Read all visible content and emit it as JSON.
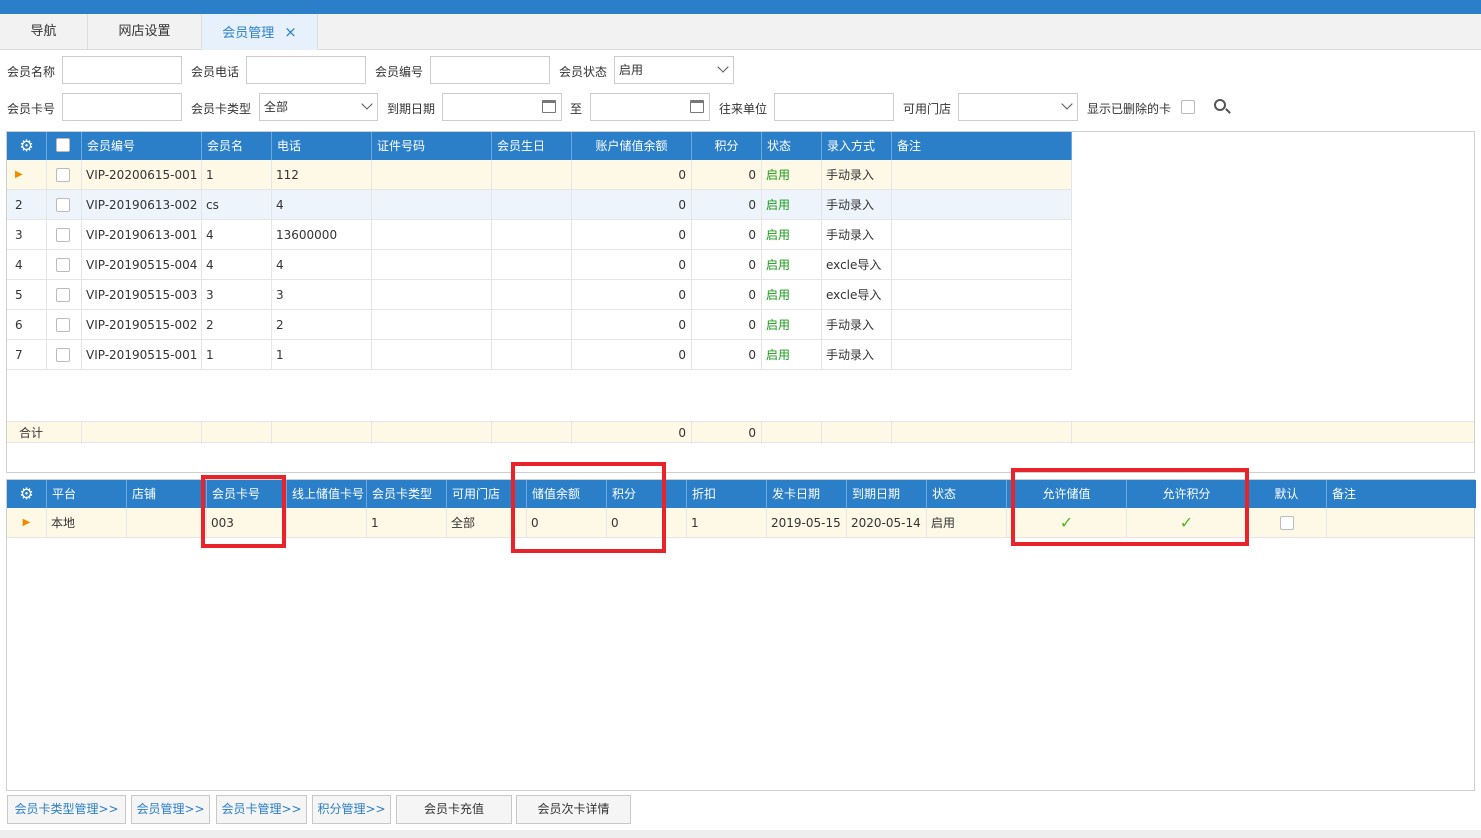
{
  "tabs": [
    {
      "label": "导航"
    },
    {
      "label": "网店设置"
    },
    {
      "label": "会员管理",
      "close": "×"
    }
  ],
  "filters": {
    "member_name": {
      "label": "会员名称",
      "value": ""
    },
    "member_phone": {
      "label": "会员电话",
      "value": ""
    },
    "member_code": {
      "label": "会员编号",
      "value": ""
    },
    "member_status": {
      "label": "会员状态",
      "value": "启用"
    },
    "card_no": {
      "label": "会员卡号",
      "value": ""
    },
    "card_type": {
      "label": "会员卡类型",
      "value": "全部"
    },
    "expire_date": {
      "label": "到期日期",
      "to": "至"
    },
    "partner": {
      "label": "往来单位",
      "value": ""
    },
    "store": {
      "label": "可用门店",
      "value": ""
    },
    "show_deleted": {
      "label": "显示已删除的卡"
    }
  },
  "member_grid": {
    "columns": [
      "会员编号",
      "会员名",
      "电话",
      "证件号码",
      "会员生日",
      "账户储值余额",
      "积分",
      "状态",
      "录入方式",
      "备注"
    ],
    "rows": [
      {
        "idx": "▶",
        "code": "VIP-20200615-001",
        "name": "1",
        "phone": "112",
        "id_no": "",
        "birthday": "",
        "balance": "0",
        "points": "0",
        "status": "启用",
        "entry": "手动录入",
        "remark": ""
      },
      {
        "idx": "2",
        "code": "VIP-20190613-002",
        "name": "cs",
        "phone": "4",
        "id_no": "",
        "birthday": "",
        "balance": "0",
        "points": "0",
        "status": "启用",
        "entry": "手动录入",
        "remark": ""
      },
      {
        "idx": "3",
        "code": "VIP-20190613-001",
        "name": "4",
        "phone": "13600000",
        "id_no": "",
        "birthday": "",
        "balance": "0",
        "points": "0",
        "status": "启用",
        "entry": "手动录入",
        "remark": ""
      },
      {
        "idx": "4",
        "code": "VIP-20190515-004",
        "name": "4",
        "phone": "4",
        "id_no": "",
        "birthday": "",
        "balance": "0",
        "points": "0",
        "status": "启用",
        "entry": "excle导入",
        "remark": ""
      },
      {
        "idx": "5",
        "code": "VIP-20190515-003",
        "name": "3",
        "phone": "3",
        "id_no": "",
        "birthday": "",
        "balance": "0",
        "points": "0",
        "status": "启用",
        "entry": "excle导入",
        "remark": ""
      },
      {
        "idx": "6",
        "code": "VIP-20190515-002",
        "name": "2",
        "phone": "2",
        "id_no": "",
        "birthday": "",
        "balance": "0",
        "points": "0",
        "status": "启用",
        "entry": "手动录入",
        "remark": ""
      },
      {
        "idx": "7",
        "code": "VIP-20190515-001",
        "name": "1",
        "phone": "1",
        "id_no": "",
        "birthday": "",
        "balance": "0",
        "points": "0",
        "status": "启用",
        "entry": "手动录入",
        "remark": ""
      }
    ],
    "total": {
      "label": "合计",
      "balance": "0",
      "points": "0"
    }
  },
  "card_grid": {
    "columns": [
      "平台",
      "店铺",
      "会员卡号",
      "线上储值卡号",
      "会员卡类型",
      "可用门店",
      "储值余额",
      "积分",
      "折扣",
      "发卡日期",
      "到期日期",
      "状态",
      "允许储值",
      "允许积分",
      "默认",
      "备注"
    ],
    "rows": [
      {
        "platform": "本地",
        "shop": "",
        "card_no": "003",
        "online_card": "",
        "card_type": "1",
        "store": "全部",
        "balance": "0",
        "points": "0",
        "discount": "1",
        "issue_date": "2019-05-15",
        "expire_date": "2020-05-14",
        "status": "启用",
        "allow_deposit": "✓",
        "allow_points": "✓",
        "remark": ""
      }
    ]
  },
  "buttons": [
    "会员卡类型管理>>",
    "会员管理>>",
    "会员卡管理>>",
    "积分管理>>",
    "会员卡充值",
    "会员次卡详情"
  ],
  "colors": {
    "header": "#2b7fc8",
    "highlight": "#e8242a",
    "status_green": "#1a9c1a"
  }
}
